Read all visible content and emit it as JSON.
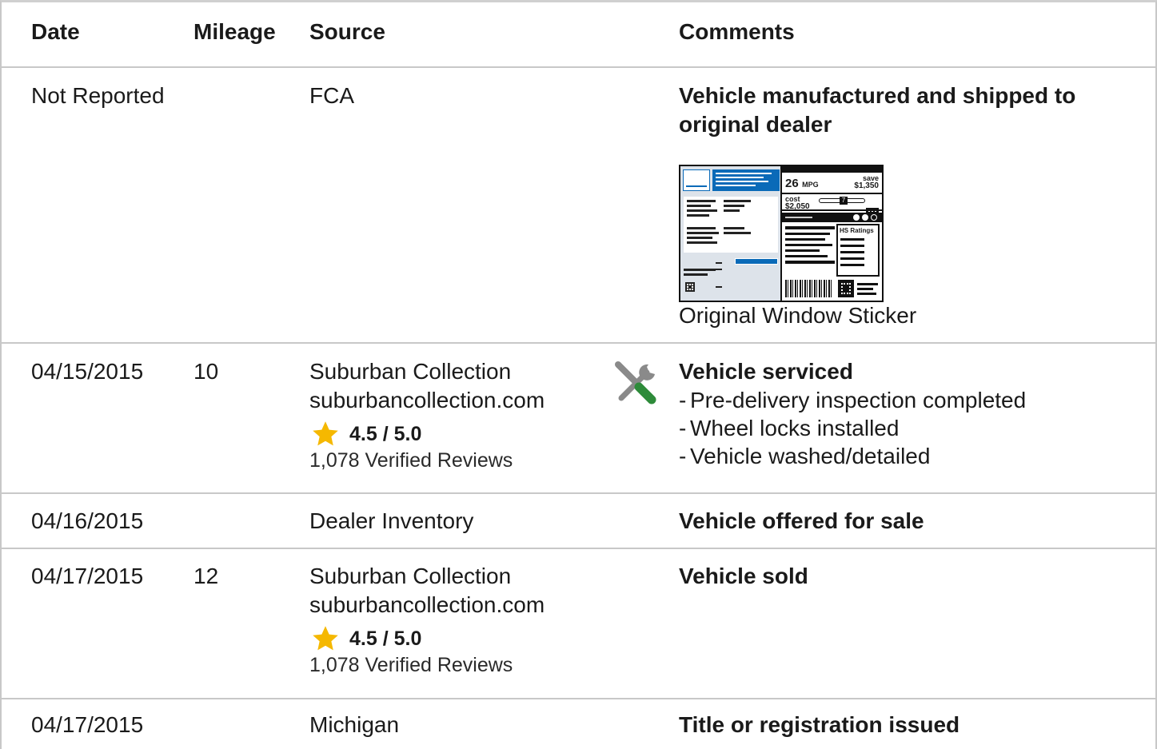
{
  "header": {
    "date": "Date",
    "mileage": "Mileage",
    "source": "Source",
    "comments": "Comments"
  },
  "rows": [
    {
      "date": "Not Reported",
      "mileage": "",
      "source": "FCA",
      "comment_title": "Vehicle manufactured and shipped to original dealer",
      "sticker": {
        "caption": "Original Window Sticker",
        "mpg": "26",
        "mpg_unit": "MPG",
        "save_label": "save",
        "save_value": "$1,350",
        "cost_label": "cost",
        "cost_value": "$2,050",
        "scale_value": "7",
        "ratings_label": "HS Ratings"
      }
    },
    {
      "date": "04/15/2015",
      "mileage": "10",
      "source_name": "Suburban Collection",
      "source_site": "suburbancollection.com",
      "rating": "4.5 / 5.0",
      "reviews": "1,078 Verified Reviews",
      "icon": "wrench-screwdriver-icon",
      "comment_title": "Vehicle serviced",
      "bullets": [
        "Pre-delivery inspection completed",
        "Wheel locks installed",
        "Vehicle washed/detailed"
      ]
    },
    {
      "date": "04/16/2015",
      "mileage": "",
      "source": "Dealer Inventory",
      "comment_title": "Vehicle offered for sale"
    },
    {
      "date": "04/17/2015",
      "mileage": "12",
      "source_name": "Suburban Collection",
      "source_site": "suburbancollection.com",
      "rating": "4.5 / 5.0",
      "reviews": "1,078 Verified Reviews",
      "comment_title": "Vehicle sold"
    },
    {
      "date": "04/17/2015",
      "mileage": "",
      "source": "Michigan",
      "comment_title": "Title or registration issued"
    }
  ],
  "colors": {
    "star": "#f5b800",
    "divider": "#c8c8c8",
    "sticker_blue": "#0a6ab8",
    "wrench_gray": "#8a8a8a",
    "screwdriver_green": "#2e8b3a"
  }
}
